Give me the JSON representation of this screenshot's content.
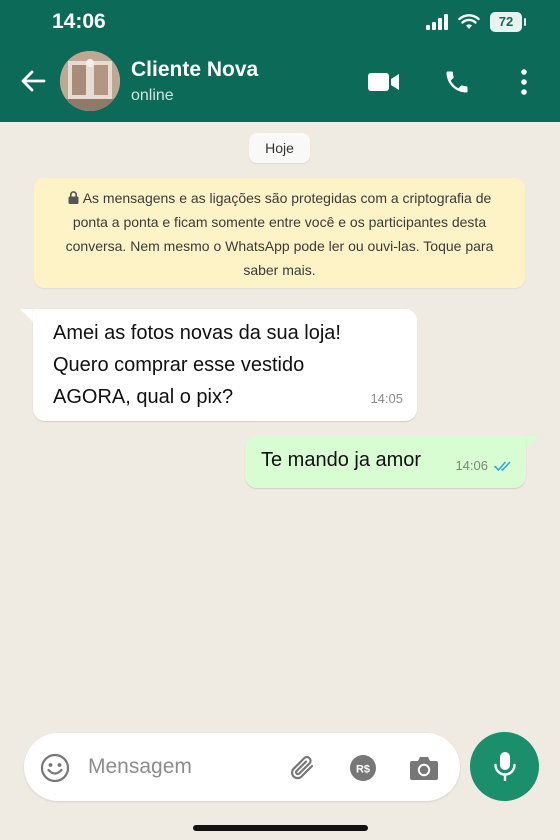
{
  "status_bar": {
    "time": "14:06",
    "battery": "72"
  },
  "header": {
    "contact_name": "Cliente Nova",
    "contact_status": "online"
  },
  "chat": {
    "date_chip": "Hoje",
    "encryption_notice": "As mensagens e as ligações são protegidas com a criptografia de ponta a ponta e ficam somente entre você e os participantes desta conversa. Nem mesmo o WhatsApp pode ler ou ouvi-las. Toque para saber mais.",
    "messages": [
      {
        "direction": "incoming",
        "text": "Amei as fotos novas da sua loja! Quero comprar esse vestido AGORA, qual o pix?",
        "time": "14:05"
      },
      {
        "direction": "outgoing",
        "text": "Te mando ja amor",
        "time": "14:06",
        "status": "read"
      }
    ]
  },
  "composer": {
    "placeholder": "Mensagem",
    "value": ""
  },
  "colors": {
    "header": "#0b6b58",
    "chat_background": "#efeae2",
    "outgoing_bubble": "#d9fdd3",
    "incoming_bubble": "#ffffff",
    "notice_background": "#fdf3c7",
    "read_ticks": "#34a8e0",
    "mic_button": "#1b8e6c"
  },
  "icons": [
    "signal-icon",
    "wifi-icon",
    "battery-icon",
    "back-arrow-icon",
    "video-call-icon",
    "phone-icon",
    "more-options-icon",
    "lock-icon",
    "double-check-icon",
    "emoji-icon",
    "attach-icon",
    "payment-icon",
    "camera-icon",
    "mic-icon"
  ]
}
